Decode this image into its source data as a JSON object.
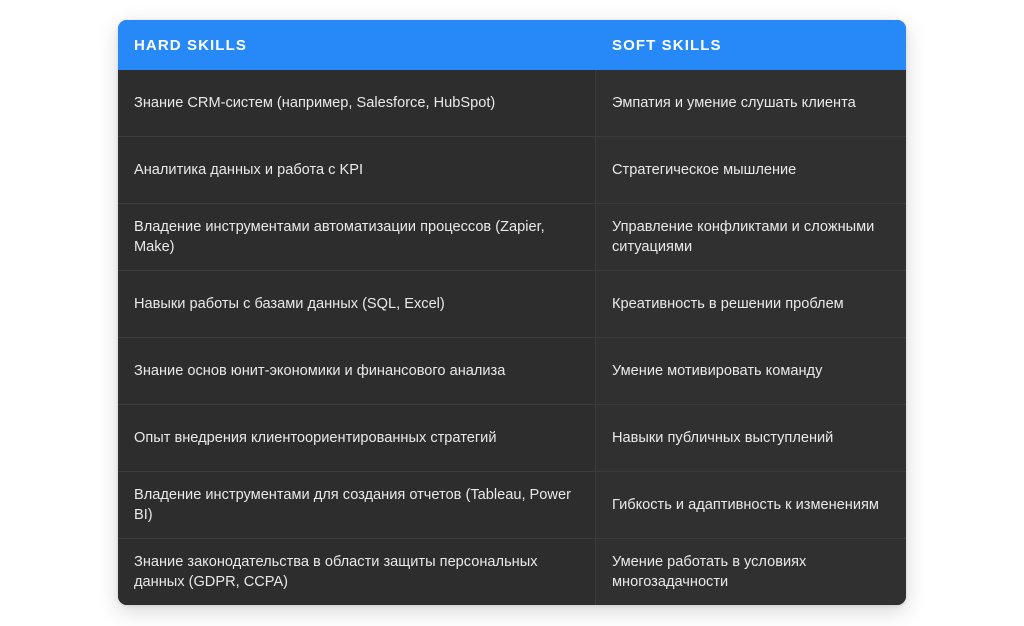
{
  "table": {
    "columns": [
      {
        "key": "hard",
        "label": "HARD SKILLS"
      },
      {
        "key": "soft",
        "label": "SOFT SKILLS"
      }
    ],
    "header_background": "#2789f7",
    "header_text_color": "#ffffff",
    "body_background": "#2d2d2d",
    "body_text_color": "#e9e9ea",
    "divider_color": "#3b3b3b",
    "page_background": "#ffffff",
    "rows": [
      {
        "hard": "Знание CRM-систем (например, Salesforce, HubSpot)",
        "soft": "Эмпатия и умение слушать клиента"
      },
      {
        "hard": "Аналитика данных и работа с KPI",
        "soft": "Стратегическое мышление"
      },
      {
        "hard": "Владение инструментами автоматизации процессов (Zapier, Make)",
        "soft": "Управление конфликтами и сложными ситуациями"
      },
      {
        "hard": "Навыки работы с базами данных (SQL, Excel)",
        "soft": "Креативность в решении проблем"
      },
      {
        "hard": "Знание основ юнит-экономики и финансового анализа",
        "soft": "Умение мотивировать команду"
      },
      {
        "hard": "Опыт внедрения клиентоориентированных стратегий",
        "soft": "Навыки публичных выступлений"
      },
      {
        "hard": "Владение инструментами для создания отчетов (Tableau, Power BI)",
        "soft": "Гибкость и адаптивность к изменениям"
      },
      {
        "hard": "Знание законодательства в области защиты персональных данных (GDPR, CCPA)",
        "soft": "Умение работать в условиях многозадачности"
      }
    ]
  }
}
